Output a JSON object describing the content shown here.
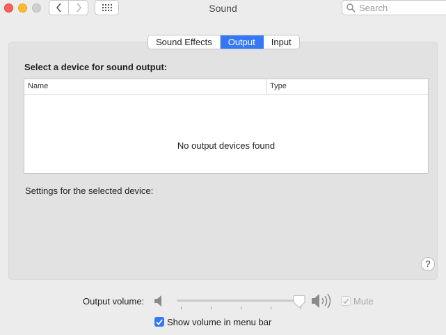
{
  "window": {
    "title": "Sound",
    "search_placeholder": "Search"
  },
  "tabs": [
    {
      "label": "Sound Effects",
      "active": false
    },
    {
      "label": "Output",
      "active": true
    },
    {
      "label": "Input",
      "active": false
    }
  ],
  "output": {
    "section_title": "Select a device for sound output:",
    "columns": [
      "Name",
      "Type"
    ],
    "empty_message": "No output devices found",
    "settings_label": "Settings for the selected device:",
    "help_label": "?"
  },
  "volume": {
    "label": "Output volume:",
    "level": 0.98,
    "mute_label": "Mute",
    "mute_checked": true,
    "mute_enabled": false
  },
  "menubar": {
    "label": "Show volume in menu bar",
    "checked": true
  },
  "colors": {
    "accent": "#3478f6",
    "close": "#ff5f57",
    "minimize": "#ffbd2e"
  }
}
